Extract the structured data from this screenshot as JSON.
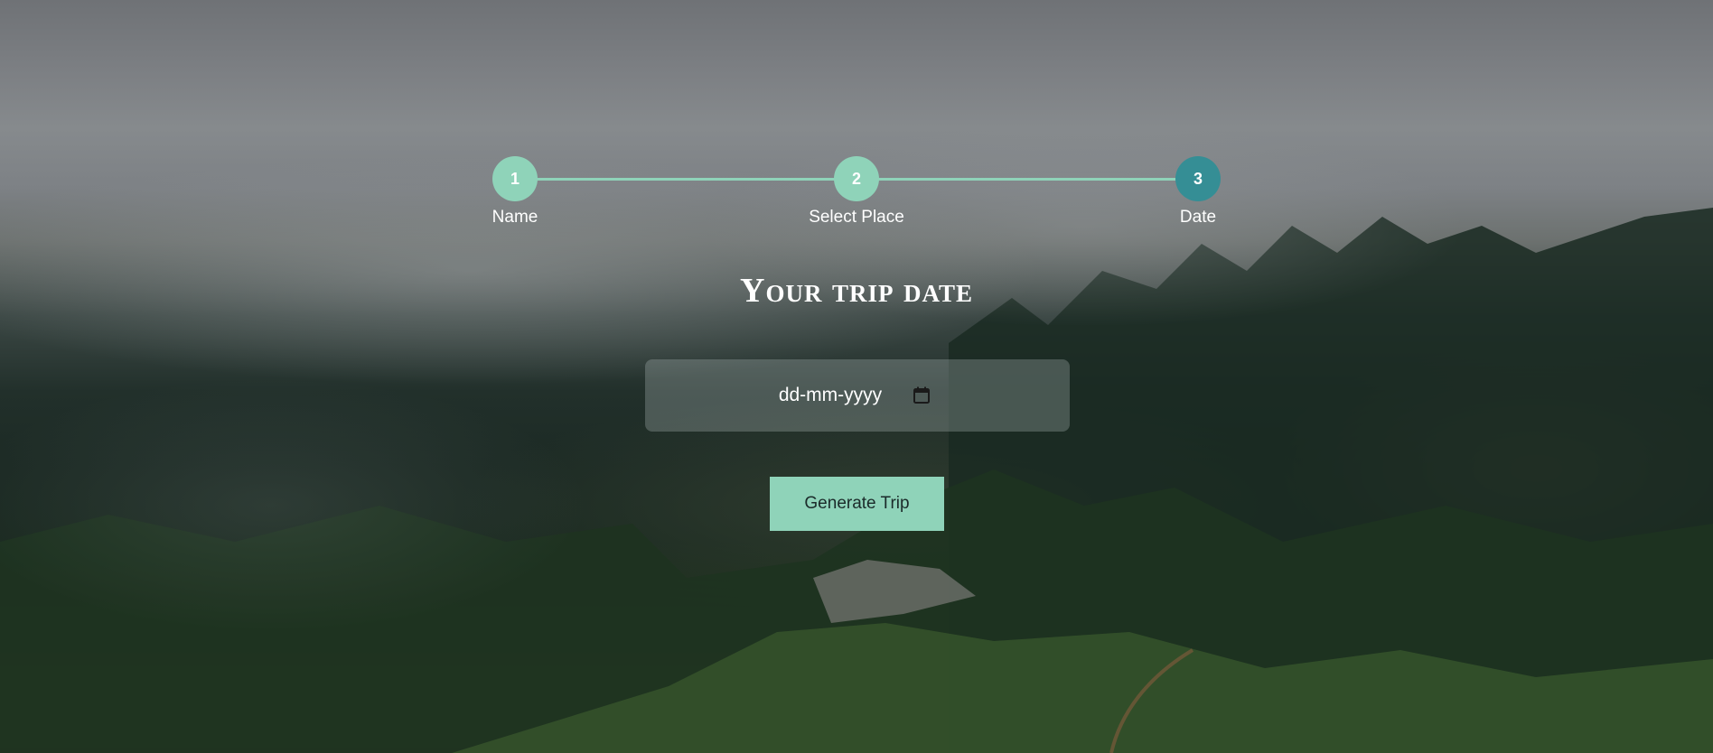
{
  "stepper": {
    "steps": [
      {
        "number": "1",
        "label": "Name",
        "state": "completed"
      },
      {
        "number": "2",
        "label": "Select Place",
        "state": "completed"
      },
      {
        "number": "3",
        "label": "Date",
        "state": "active"
      }
    ],
    "completed_color": "#8fd3b9",
    "active_color": "#358e95"
  },
  "main": {
    "title": "Your trip date",
    "date_input": {
      "placeholder": "dd-mm-yyyy",
      "value": "",
      "icon": "calendar-icon"
    },
    "generate_button_label": "Generate Trip"
  },
  "colors": {
    "accent": "#8fd3b9",
    "button_text": "#1b2b2a"
  }
}
